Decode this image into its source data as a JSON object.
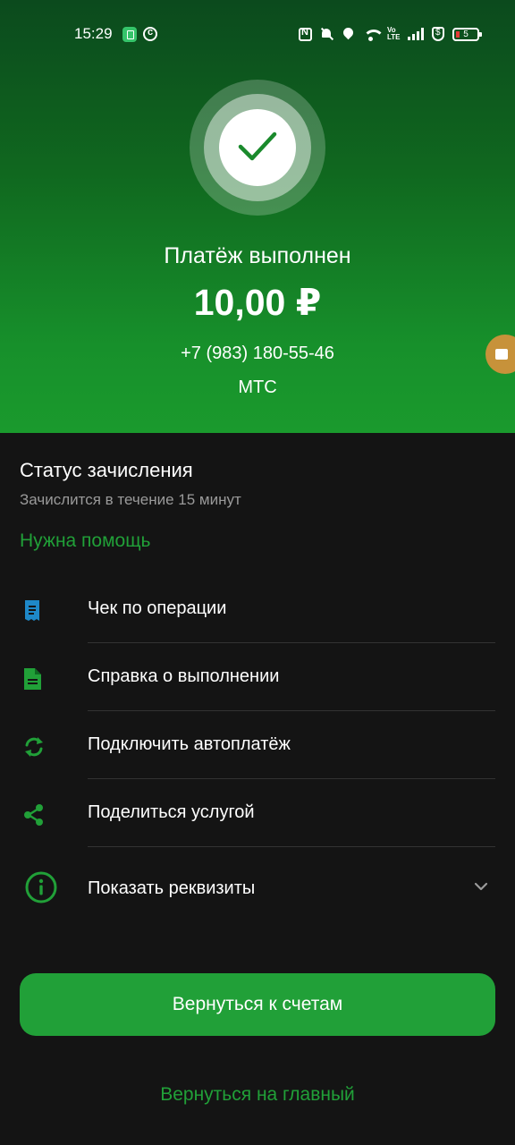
{
  "status_bar": {
    "time": "15:29",
    "battery_level": "5",
    "icons": [
      "app-notification-icon",
      "c-app-icon",
      "nfc-icon",
      "mute-icon",
      "location-icon",
      "wifi-icon",
      "volte-icon",
      "signal-icon",
      "shield-icon",
      "battery-icon"
    ]
  },
  "hero": {
    "title": "Платёж выполнен",
    "amount": "10,00 ₽",
    "phone": "+7 (983) 180-55-46",
    "operator": "МТС",
    "accent_color": "#1a9a2d"
  },
  "status": {
    "title": "Статус зачисления",
    "subtitle": "Зачислится в течение 15 минут"
  },
  "help_link": "Нужна помощь",
  "menu": [
    {
      "label": "Чек по операции",
      "icon": "receipt-icon"
    },
    {
      "label": "Справка о выполнении",
      "icon": "document-icon"
    },
    {
      "label": "Подключить автоплатёж",
      "icon": "autopay-icon"
    },
    {
      "label": "Поделиться услугой",
      "icon": "share-icon"
    },
    {
      "label": "Показать реквизиты",
      "icon": "info-icon"
    }
  ],
  "buttons": {
    "primary": "Вернуться к счетам",
    "secondary": "Вернуться на главный"
  },
  "colors": {
    "brand_green": "#21a038",
    "background": "#141414",
    "receipt_icon": "#1e88c8"
  }
}
